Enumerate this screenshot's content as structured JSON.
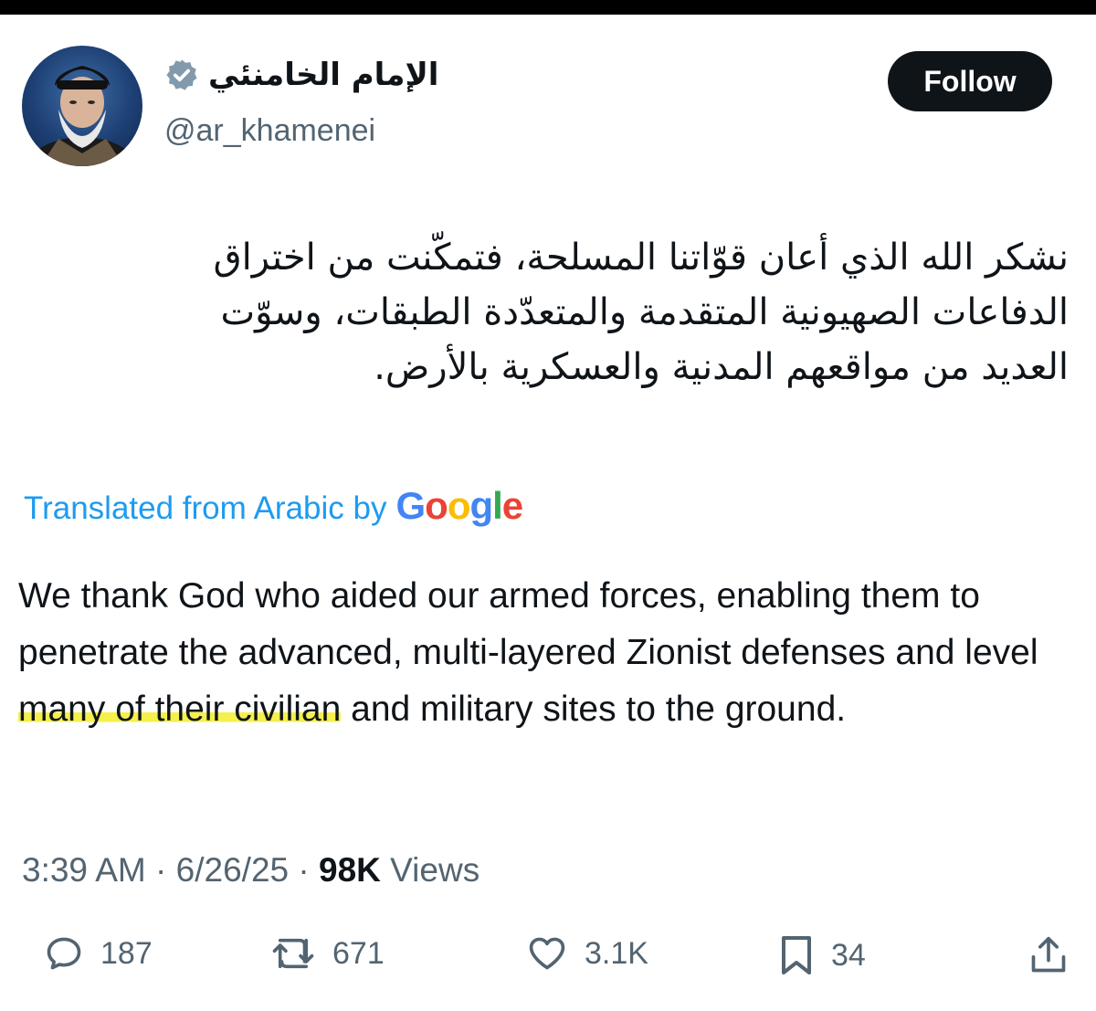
{
  "profile": {
    "display_name": "الإمام الخامنئي",
    "handle": "@ar_khamenei",
    "avatar_icon": "profile-photo",
    "verified_icon": "verified-badge-icon"
  },
  "follow_label": "Follow",
  "tweet": {
    "arabic_lines": [
      "نشكر الله الذي أعان قوّاتنا المسلحة، فتمكّنت من اختراق",
      "الدفاعات الصهيونية المتقدمة والمتعدّدة الطبقات، وسوّت",
      "العديد من مواقعهم المدنية والعسكرية بالأرض."
    ],
    "translated_label": "Translated from Arabic by",
    "google_logo": "Google",
    "english": {
      "before_highlight": "We thank God who aided our armed forces, enabling them to penetrate the advanced, multi-layered Zionist defenses and level",
      "highlighted": " many of their civilian",
      "after_highlight": " and military sites to the ground."
    },
    "highlight_color": "#f5f04a"
  },
  "meta": {
    "time": "3:39 AM",
    "separator": " · ",
    "date": "6/26/25",
    "views_count": "98K",
    "views_label": " Views"
  },
  "actions": {
    "replies": "187",
    "reposts": "671",
    "likes": "3.1K",
    "bookmarks": "34"
  },
  "colors": {
    "text": "#0f1419",
    "secondary": "#536471",
    "link": "#1d9bf0",
    "button_bg": "#0f1419"
  }
}
